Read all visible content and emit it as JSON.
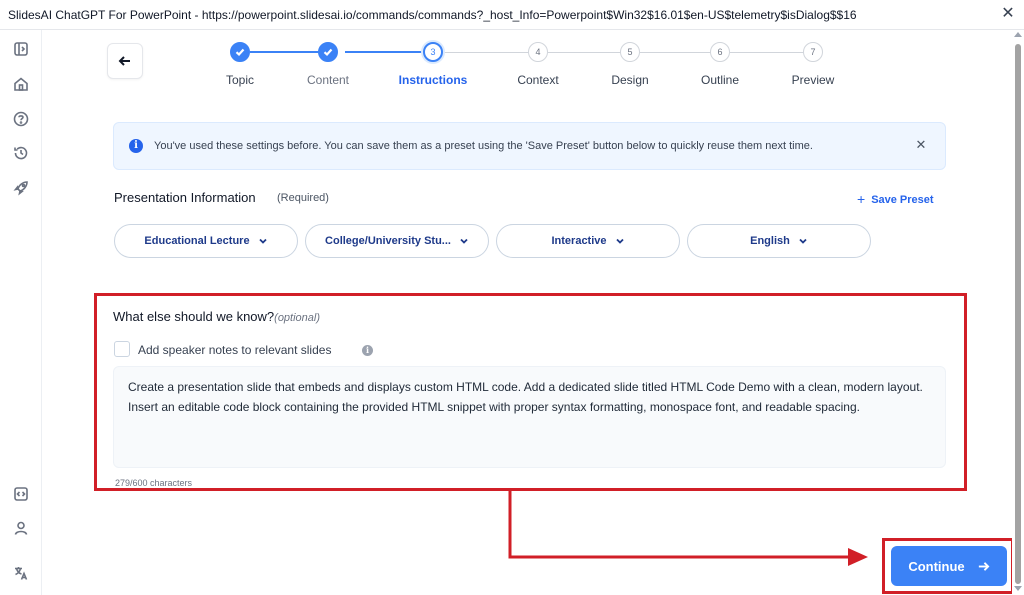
{
  "window": {
    "title": "SlidesAI ChatGPT For PowerPoint - https://powerpoint.slidesai.io/commands/commands?_host_Info=Powerpoint$Win32$16.01$en-US$telemetry$isDialog$$16"
  },
  "sidebar": {
    "icons": [
      "sidebar-toggle-icon",
      "home-icon",
      "help-icon",
      "history-icon",
      "rocket-icon",
      "code-icon",
      "user-icon",
      "translate-icon"
    ]
  },
  "stepper": {
    "steps": [
      {
        "number": "1",
        "label": "Topic",
        "state": "done"
      },
      {
        "number": "2",
        "label": "Content",
        "state": "done"
      },
      {
        "number": "3",
        "label": "Instructions",
        "state": "active"
      },
      {
        "number": "4",
        "label": "Context",
        "state": "todo"
      },
      {
        "number": "5",
        "label": "Design",
        "state": "todo"
      },
      {
        "number": "6",
        "label": "Outline",
        "state": "todo"
      },
      {
        "number": "7",
        "label": "Preview",
        "state": "todo"
      }
    ]
  },
  "banner": {
    "icon": "i",
    "text": "You've used these settings before. You can save them as a preset using the 'Save Preset' button below to quickly reuse them next time."
  },
  "presentation": {
    "title": "Presentation Information",
    "required": "(Required)",
    "save_preset": "Save Preset",
    "options": [
      "Educational Lecture",
      "College/University Stu...",
      "Interactive",
      "English"
    ]
  },
  "extra": {
    "title": "What else should we know?",
    "optional": "(optional)",
    "checkbox_label": "Add speaker notes to relevant slides",
    "text": "Create a presentation slide that embeds and displays custom HTML code. Add a dedicated slide titled HTML Code Demo with a clean, modern layout. Insert an editable code block containing the provided HTML snippet with proper syntax formatting, monospace font, and readable spacing.",
    "char_count": "279/600 characters"
  },
  "continue": {
    "label": "Continue"
  },
  "colors": {
    "accent": "#3b82f6",
    "annotation": "#d11f27",
    "pill_text": "#1e3a8a"
  }
}
